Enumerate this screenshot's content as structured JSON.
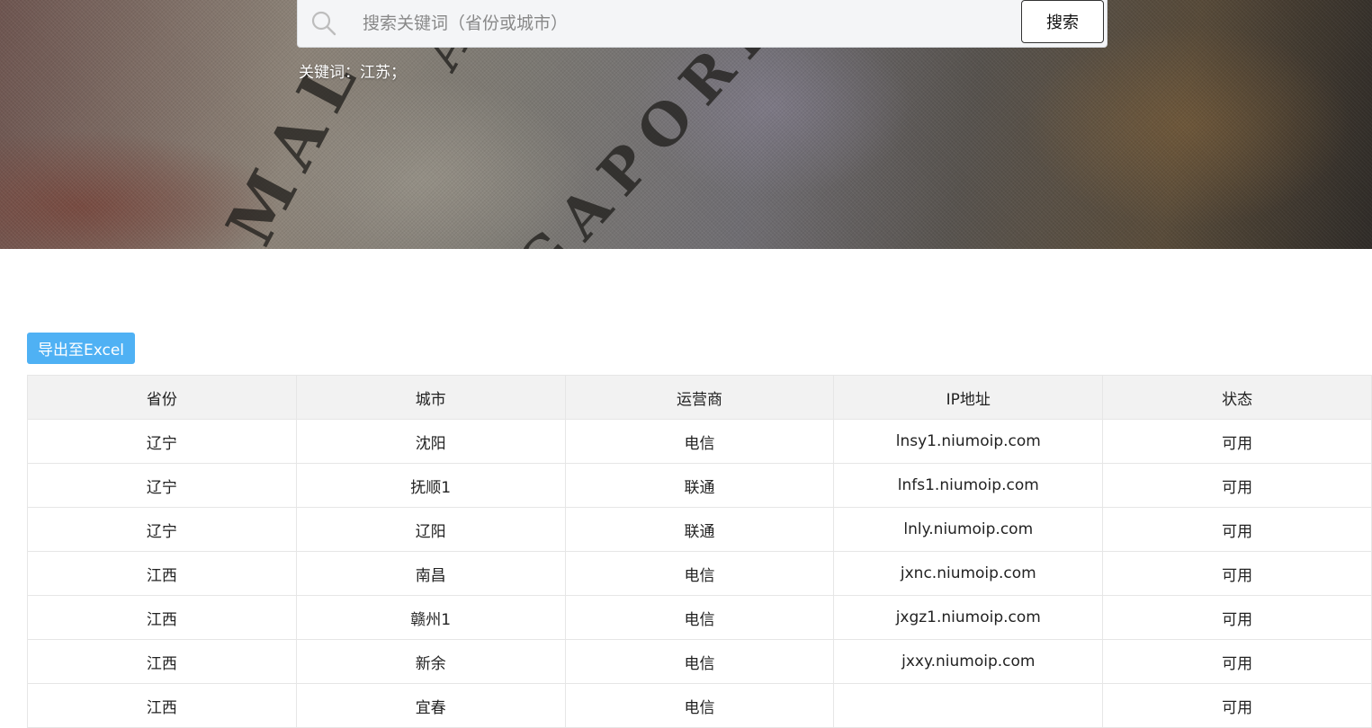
{
  "search": {
    "placeholder": "搜索关键词（省份或城市）",
    "value": "",
    "button_label": "搜索",
    "keyword_prefix": "关键词：",
    "keyword_value": "江苏；"
  },
  "toolbar": {
    "export_label": "导出至Excel"
  },
  "table": {
    "headers": [
      "省份",
      "城市",
      "运营商",
      "IP地址",
      "状态"
    ],
    "rows": [
      [
        "辽宁",
        "沈阳",
        "电信",
        "lnsy1.niumoip.com",
        "可用"
      ],
      [
        "辽宁",
        "抚顺1",
        "联通",
        "lnfs1.niumoip.com",
        "可用"
      ],
      [
        "辽宁",
        "辽阳",
        "联通",
        "lnly.niumoip.com",
        "可用"
      ],
      [
        "江西",
        "南昌",
        "电信",
        "jxnc.niumoip.com",
        "可用"
      ],
      [
        "江西",
        "赣州1",
        "电信",
        "jxgz1.niumoip.com",
        "可用"
      ],
      [
        "江西",
        "新余",
        "电信",
        "jxxy.niumoip.com",
        "可用"
      ],
      [
        "江西",
        "宜春",
        "电信",
        "",
        "可用"
      ]
    ]
  },
  "colors": {
    "export_button": "#4fb1f4",
    "header_bg": "#f2f2f2",
    "search_bg": "#f4f5f7"
  },
  "icons": {
    "search": "search-icon"
  }
}
